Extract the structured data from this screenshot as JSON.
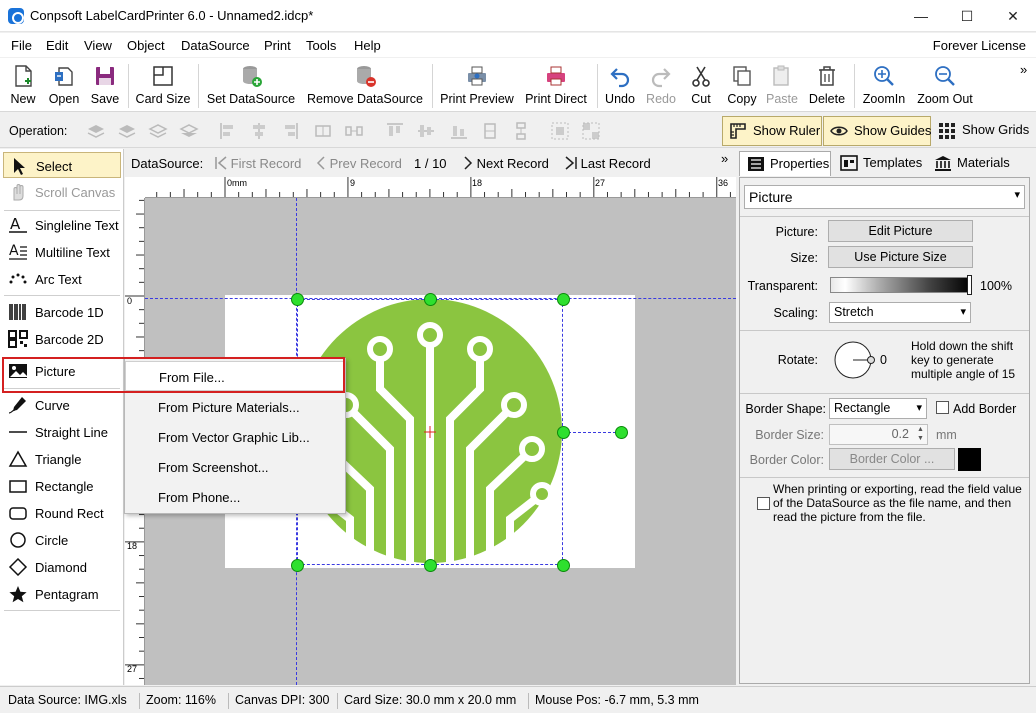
{
  "window": {
    "title": "Conpsoft LabelCardPrinter 6.0 - Unnamed2.idcp*",
    "minimize": "—",
    "maximize": "☐",
    "close": "✕"
  },
  "menu": {
    "items": [
      "File",
      "Edit",
      "View",
      "Object",
      "DataSource",
      "Print",
      "Tools",
      "Help"
    ],
    "license": "Forever License"
  },
  "toolbar": {
    "new": "New",
    "open": "Open",
    "save": "Save",
    "card_size": "Card Size",
    "set_datasource": "Set DataSource",
    "remove_datasource": "Remove DataSource",
    "print_preview": "Print Preview",
    "print_direct": "Print Direct",
    "undo": "Undo",
    "redo": "Redo",
    "cut": "Cut",
    "copy": "Copy",
    "paste": "Paste",
    "delete": "Delete",
    "zoom_in": "ZoomIn",
    "zoom_out": "Zoom Out",
    "more": "»"
  },
  "opbar": {
    "label": "Operation:",
    "show_ruler": "Show Ruler",
    "show_guides": "Show Guides",
    "show_grids": "Show Grids"
  },
  "tools": {
    "select": "Select",
    "scroll_canvas": "Scroll Canvas",
    "singleline_text": "Singleline Text",
    "multiline_text": "Multiline Text",
    "arc_text": "Arc Text",
    "barcode_1d": "Barcode 1D",
    "barcode_2d": "Barcode 2D",
    "picture": "Picture",
    "curve": "Curve",
    "straight_line": "Straight Line",
    "triangle": "Triangle",
    "rectangle": "Rectangle",
    "round_rect": "Round Rect",
    "circle": "Circle",
    "diamond": "Diamond",
    "pentagram": "Pentagram"
  },
  "datasource_bar": {
    "label": "DataSource:",
    "first": "First Record",
    "prev": "Prev Record",
    "position": "1 / 10",
    "next": "Next Record",
    "last": "Last Record",
    "more": "»"
  },
  "rulers": {
    "h_ticks": [
      "0mm",
      "9",
      "18",
      "27",
      "36"
    ],
    "v_ticks": [
      "0",
      "9",
      "18",
      "27"
    ]
  },
  "dropdown": {
    "items": [
      "From File...",
      "From Picture Materials...",
      "From Vector Graphic Lib...",
      "From Screenshot...",
      "From Phone..."
    ]
  },
  "right_panel": {
    "tabs": [
      "Properties",
      "Templates",
      "Materials"
    ],
    "object_type": "Picture",
    "picture_label": "Picture:",
    "edit_picture": "Edit Picture",
    "size_label": "Size:",
    "use_picture_size": "Use Picture Size",
    "transparent_label": "Transparent:",
    "transparent_value": "100%",
    "scaling_label": "Scaling:",
    "scaling_value": "Stretch",
    "rotate_label": "Rotate:",
    "rotate_value": "0",
    "rotate_hint": "Hold down the shift key to generate multiple angle of 15",
    "border_shape_label": "Border Shape:",
    "border_shape_value": "Rectangle",
    "add_border": "Add Border",
    "border_size_label": "Border Size:",
    "border_size_value": "0.2",
    "border_size_unit": "mm",
    "border_color_label": "Border Color:",
    "border_color_button": "Border Color ...",
    "border_color": "#000000",
    "datasource_hint": "When printing or exporting, read the field value of the DataSource as the file name, and then read the picture from the file."
  },
  "status": {
    "data_source": "Data Source: IMG.xls",
    "zoom": "Zoom: 116%",
    "dpi": "Canvas DPI: 300",
    "card_size": "Card Size: 30.0 mm x 20.0 mm",
    "mouse_pos": "Mouse Pos: -6.7 mm, 5.3 mm"
  },
  "colors": {
    "logo_green": "#8bc540",
    "handle_green": "#2ee02e",
    "guide_blue": "#3a3ae0",
    "highlight_red": "#d42020",
    "selected_bg": "#fdf3c8"
  }
}
